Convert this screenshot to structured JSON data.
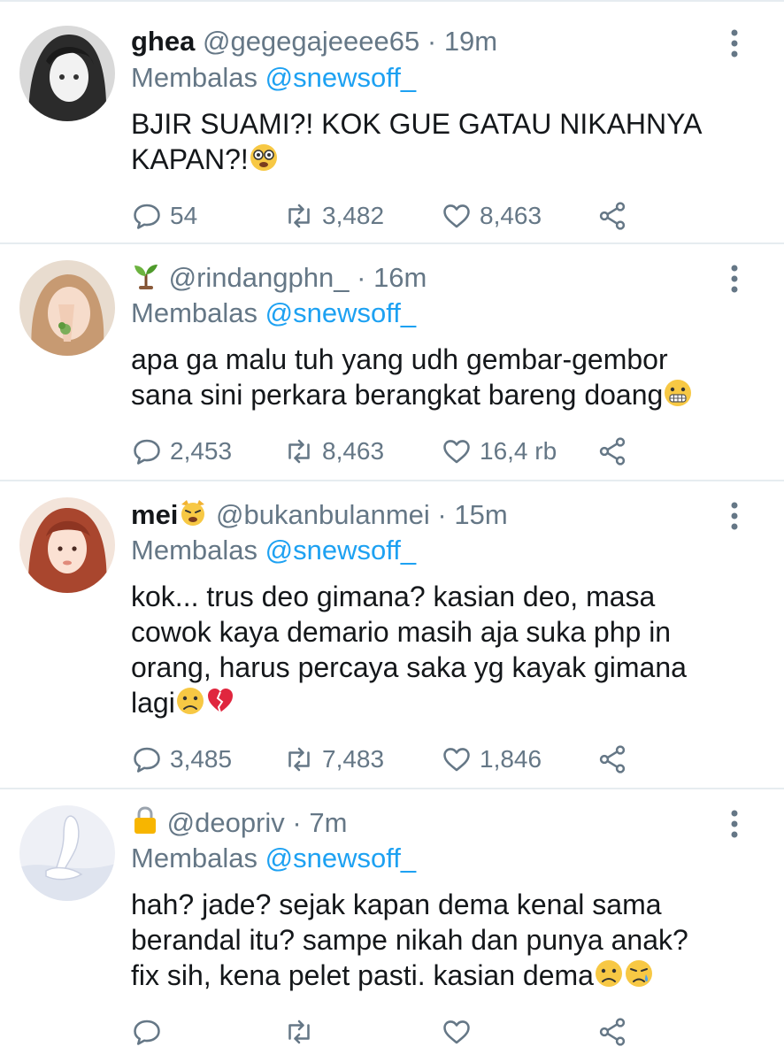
{
  "tweets": [
    {
      "name": "ghea",
      "handle": "@gegegajeeee65",
      "time": "19m",
      "reply_prefix": "Membalas",
      "reply_to": "@snewsoff_",
      "text_lines": [
        "BJIR SUAMI?! KOK GUE GATAU NIKAHNYA",
        "KAPAN?!"
      ],
      "emoji": "dizzy-face-emoji",
      "replies": "54",
      "retweets": "3,482",
      "likes": "8,463"
    },
    {
      "name": "",
      "name_icon": "seedling-icon",
      "handle": "@rindangphn_",
      "time": "16m",
      "reply_prefix": "Membalas",
      "reply_to": "@snewsoff_",
      "text_lines": [
        "apa ga malu tuh yang udh gembar-gembor",
        "sana sini perkara berangkat bareng doang"
      ],
      "emoji": "grimacing-face-emoji",
      "replies": "2,453",
      "retweets": "8,463",
      "likes": "16,4 rb"
    },
    {
      "name": "mei",
      "name_icon": "weary-cat-icon",
      "handle": "@bukanbulanmei",
      "time": "15m",
      "reply_prefix": "Membalas",
      "reply_to": "@snewsoff_",
      "text_lines": [
        "kok... trus deo gimana? kasian deo, masa",
        "cowok kaya demario masih aja suka php in",
        "orang, harus percaya saka yg kayak gimana",
        "lagi"
      ],
      "emoji": "worried-face-broken-heart-emoji",
      "replies": "3,485",
      "retweets": "7,483",
      "likes": "1,846"
    },
    {
      "name": "",
      "name_icon": "lock-icon",
      "handle": "@deopriv",
      "time": "7m",
      "reply_prefix": "Membalas",
      "reply_to": "@snewsoff_",
      "text_lines": [
        "hah? jade? sejak kapan dema kenal sama",
        "berandal itu? sampe nikah dan punya anak?",
        "fix sih, kena pelet pasti. kasian dema"
      ],
      "emoji": "worried-crying-face-emoji",
      "replies": "",
      "retweets": "",
      "likes": ""
    }
  ],
  "colors": {
    "accent": "#1da1f2",
    "muted": "#657786",
    "text": "#14171a",
    "divider": "#e6ecf0"
  }
}
